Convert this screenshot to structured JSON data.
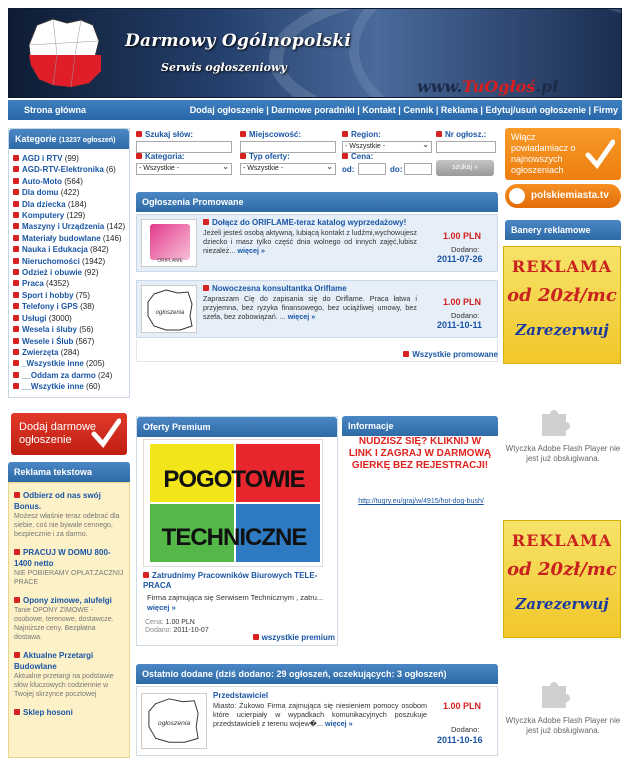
{
  "header": {
    "title": "Darmowy Ogólnopolski",
    "subtitle": "Serwis ogłoszeniowy",
    "url_prefix": "www.",
    "url_brand": "TuOgłoś",
    "url_suffix": ".pl"
  },
  "nav": {
    "home": "Strona główna",
    "links": [
      "Dodaj ogłoszenie",
      "Darmowe poradniki",
      "Kontakt",
      "Cennik",
      "Reklama",
      "Edytuj/usuń ogłoszenie",
      "Firmy"
    ]
  },
  "categories": {
    "title": "Kategorie",
    "count": "(13237 ogłoszeń)",
    "items": [
      {
        "name": "AGD i RTV",
        "count": "(99)"
      },
      {
        "name": "AGD-RTV-Elektronika",
        "count": "(6)"
      },
      {
        "name": "Auto-Moto",
        "count": "(564)"
      },
      {
        "name": "Dla domu",
        "count": "(422)"
      },
      {
        "name": "Dla dziecka",
        "count": "(184)"
      },
      {
        "name": "Komputery",
        "count": "(129)"
      },
      {
        "name": "Maszyny i Urządzenia",
        "count": "(142)"
      },
      {
        "name": "Materiały budowlane",
        "count": "(146)"
      },
      {
        "name": "Nauka i Edukacja",
        "count": "(842)"
      },
      {
        "name": "Nieruchomości",
        "count": "(1942)"
      },
      {
        "name": "Odzież i obuwie",
        "count": "(92)"
      },
      {
        "name": "Praca",
        "count": "(4352)"
      },
      {
        "name": "Sport i hobby",
        "count": "(75)"
      },
      {
        "name": "Telefony i GPS",
        "count": "(38)"
      },
      {
        "name": "Usługi",
        "count": "(3000)"
      },
      {
        "name": "Wesela i śluby",
        "count": "(56)"
      },
      {
        "name": "Wesele i Ślub",
        "count": "(567)"
      },
      {
        "name": "Zwierzęta",
        "count": "(284)"
      },
      {
        "name": "_Wszystkie inne",
        "count": "(205)"
      },
      {
        "name": "__Oddam za darmo",
        "count": "(24)"
      },
      {
        "name": "__Wszytkie inne",
        "count": "(60)"
      }
    ]
  },
  "add_button": {
    "line1": "Dodaj darmowe",
    "line2": "ogłoszenie"
  },
  "text_ads": {
    "title": "Reklama tekstowa",
    "items": [
      {
        "title": "Odbierz od nas swój Bonus.",
        "desc": "Możesz właśnie teraz odebrać dla siebie, coś nie bywale cennego, bezpiecznie i za darmo."
      },
      {
        "title": "PRACUJ W DOMU 800-1400 netto",
        "desc": "NIE POBIERAMY OPŁAT.ZACZNIJ PRACE"
      },
      {
        "title": "Opony zimowe, alufelgi",
        "desc": "Tanie OPONY ZIMOWE - osobowe, terenowe, dostawcze. Najniższe ceny. Bezpłatna dostawa."
      },
      {
        "title": "Aktualne Przetargi Budowlane",
        "desc": "Aktualne przetargi na podstawie słów kluczowych codziennie w Twojej skrzynce pocztowej"
      },
      {
        "title": "Sklep hosoni",
        "desc": ""
      }
    ]
  },
  "search": {
    "words_label": "Szukaj słów:",
    "place_label": "Miejscowość:",
    "region_label": "Region:",
    "number_label": "Nr ogłosz.:",
    "region_value": "- Wszystkie -",
    "category_label": "Kategoria:",
    "category_value": "- Wszystkie -",
    "type_label": "Typ oferty:",
    "type_value": "- Wszystkie -",
    "price_label": "Cena:",
    "from_label": "od:",
    "to_label": "do:",
    "button": "szukaj »"
  },
  "promo": {
    "title": "Ogłoszenia Promowane",
    "items": [
      {
        "title": "Dołącz do ORIFLAME-teraz katalog wyprzedażowy!",
        "desc": "Jeżeli jesteś osobą aktywną, lubiącą kontakt z ludźmi,wychowujesz dziecko i masz tylko część dnia wolnego od innych zajęć,lubisz niezależ...",
        "more": "więcej »",
        "price": "1.00 PLN",
        "date_label": "Dodano:",
        "date": "2011-07-26"
      },
      {
        "title": "Nowoczesna konsultantka Oriflame",
        "desc": "Zapraszam Cię do zapisania się do Oriflame. Praca łatwa i przyjemna, bez ryzyka finansowego, bez uciążliwej umowy, bez szefa, bez zobowiązań. ...",
        "more": "więcej »",
        "price": "1.00 PLN",
        "date_label": "Dodano:",
        "date": "2011-10-11"
      }
    ],
    "all_link": "Wszystkie promowane"
  },
  "premium": {
    "title": "Oferty Premium",
    "image_words": [
      "POGOTOWIE",
      "TECHNICZNE"
    ],
    "item_title": "Zatrudnimy Pracowników Biurowych TELE-PRACA",
    "item_desc": "Firma zajmująca się Serwisem Technicznym , zatru...",
    "more": "więcej »",
    "price_label": "Cena:",
    "price": "1.00 PLN",
    "date_label": "Dodano:",
    "date": "2011-10-07",
    "all_link": "wszystkie premium"
  },
  "info": {
    "title": "Informacje",
    "text": "NUDZISZ SIĘ? KLIKNIJ W LINK I ZAGRAJ W DARMOWĄ GIERKĘ BEZ REJESTRACJI!",
    "link": "http://tugry.eu/graj/w/4915/hot-dog-bush/"
  },
  "recent": {
    "title": "Ostatnio dodane (dziś dodano: 29 ogłoszeń, oczekujących: 3 ogłoszeń)",
    "item": {
      "title": "Przedstawiciel",
      "desc": "Miasto: Żukowo Firma zajmująca się niesieniem pomocy osobom które ucierpiały w wypadkach komunikacyjnych poszukuje przedstawicieli z terenu wojew�...",
      "more": "więcej »",
      "price": "1.00 PLN",
      "date_label": "Dodano:",
      "date": "2011-10-16"
    }
  },
  "right": {
    "notify": "Włącz powiadamiacz o najnowszych ogłoszeniach",
    "pm_label": "polskiemiasta.tv",
    "banner_title": "Banery reklamowe",
    "reklama": {
      "l1": "REKLAMA",
      "l2": "od 20zł/mc",
      "l3": "Zarezerwuj"
    },
    "flash_text": "Wtyczka Adobe Flash Player nie jest już obsługiwana."
  },
  "colors": {
    "accent_blue": "#2d6aa6",
    "link_blue": "#1a56a5",
    "price_red": "#d41e1e",
    "cta_red": "#c01e12",
    "notify_orange": "#ee7f10"
  }
}
